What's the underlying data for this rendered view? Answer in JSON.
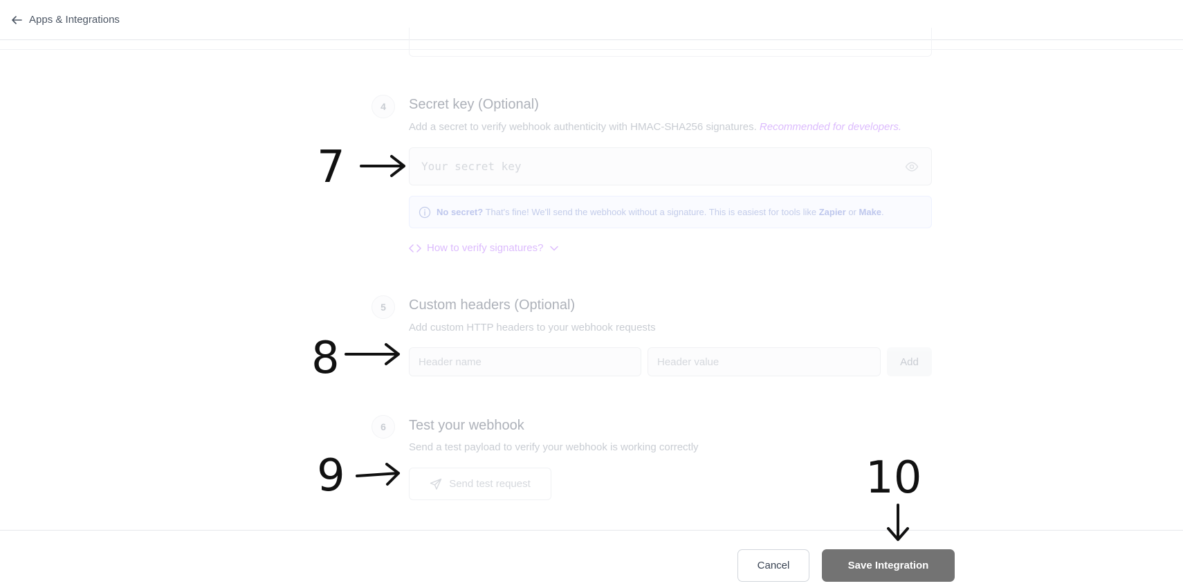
{
  "header": {
    "title": "Apps & Integrations",
    "back_icon": "arrow-left-icon"
  },
  "steps": {
    "secret": {
      "number": "4",
      "title": "Secret key (Optional)",
      "description": "Add a secret to verify webhook authenticity with HMAC-SHA256 signatures.",
      "recommendation": "Recommended for developers.",
      "input_placeholder": "Your secret key",
      "info": {
        "lead": "No secret?",
        "text": " That's fine! We'll send the webhook without a signature. This is easiest for tools like ",
        "tool1": "Zapier",
        "or": " or ",
        "tool2": "Make",
        "end": "."
      },
      "verify_link": "How to verify signatures?"
    },
    "headers": {
      "number": "5",
      "title": "Custom headers (Optional)",
      "description": "Add custom HTTP headers to your webhook requests",
      "name_placeholder": "Header name",
      "value_placeholder": "Header value",
      "add_label": "Add"
    },
    "test": {
      "number": "6",
      "title": "Test your webhook",
      "description": "Send a test payload to verify your webhook is working correctly",
      "button_label": "Send test request"
    }
  },
  "footer": {
    "cancel_label": "Cancel",
    "save_label": "Save Integration"
  },
  "annotations": [
    "7",
    "8",
    "9",
    "10"
  ],
  "colors": {
    "accent": "#c084fc",
    "save_button": "#737373",
    "info_text": "#93a3d9"
  }
}
